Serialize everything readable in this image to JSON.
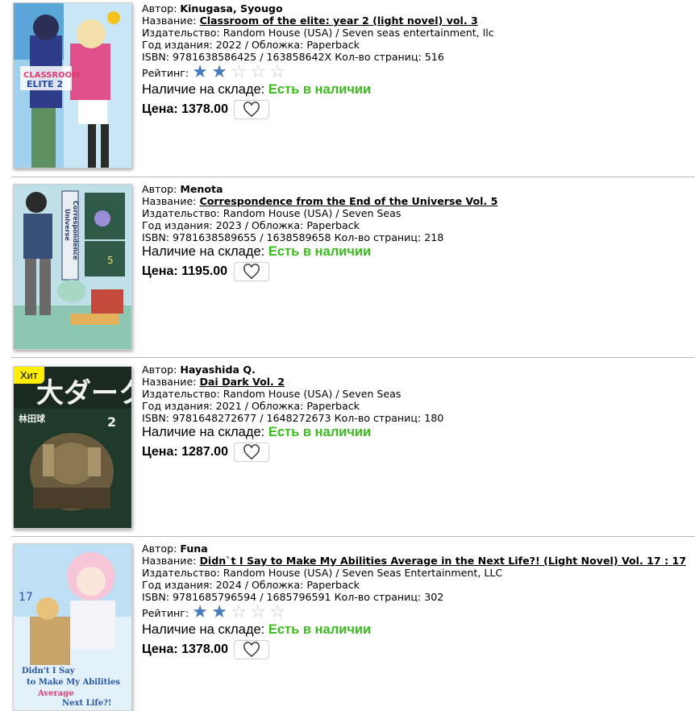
{
  "labels": {
    "author": "Автор:",
    "title": "Название:",
    "publisher": "Издательство:",
    "year": "Год издания:",
    "cover": "Обложка:",
    "isbn": "ISBN:",
    "pages": "Кол-во страниц:",
    "rating": "Рейтинг:",
    "stock": "Наличие на складе:",
    "price": "Цена:"
  },
  "colors": {
    "accent_star": "#4a7cbd",
    "in_stock": "#3cbc1e",
    "badge": "#ffee00"
  },
  "books": [
    {
      "author": "Kinugasa, Syougo",
      "title": "Classroom of the elite: year 2 (light novel) vol. 3",
      "publisher": "Random House (USA) / Seven seas entertainment, llc",
      "year": "2022",
      "cover_type": "Paperback",
      "isbn": "9781638586425 / 163858642X",
      "pages": "516",
      "rating": 2,
      "rating_max": 5,
      "stock_status": "Есть в наличии",
      "price": "1378.00",
      "badge": "",
      "cover_icon": "book-cover-image"
    },
    {
      "author": "Menota",
      "title": "Correspondence from the End of the Universe Vol. 5",
      "publisher": "Random House (USA) / Seven Seas",
      "year": "2023",
      "cover_type": "Paperback",
      "isbn": "9781638589655 / 1638589658",
      "pages": "218",
      "rating": null,
      "stock_status": "Есть в наличии",
      "price": "1195.00",
      "badge": "",
      "cover_icon": "book-cover-image"
    },
    {
      "author": "Hayashida Q.",
      "title": "Dai Dark Vol. 2",
      "publisher": "Random House (USA) / Seven Seas",
      "year": "2021",
      "cover_type": "Paperback",
      "isbn": "9781648272677 / 1648272673",
      "pages": "180",
      "rating": null,
      "stock_status": "Есть в наличии",
      "price": "1287.00",
      "badge": "Хит",
      "cover_icon": "book-cover-image"
    },
    {
      "author": "Funa",
      "title": "Didn`t I Say to Make My Abilities Average in the Next Life?! (Light Novel) Vol. 17 : 17",
      "publisher": "Random House (USA) / Seven Seas Entertainment, LLC",
      "year": "2024",
      "cover_type": "Paperback",
      "isbn": "9781685796594 / 1685796591",
      "pages": "302",
      "rating": 2,
      "rating_max": 5,
      "stock_status": "Есть в наличии",
      "price": "1378.00",
      "badge": "",
      "cover_icon": "book-cover-image"
    }
  ]
}
